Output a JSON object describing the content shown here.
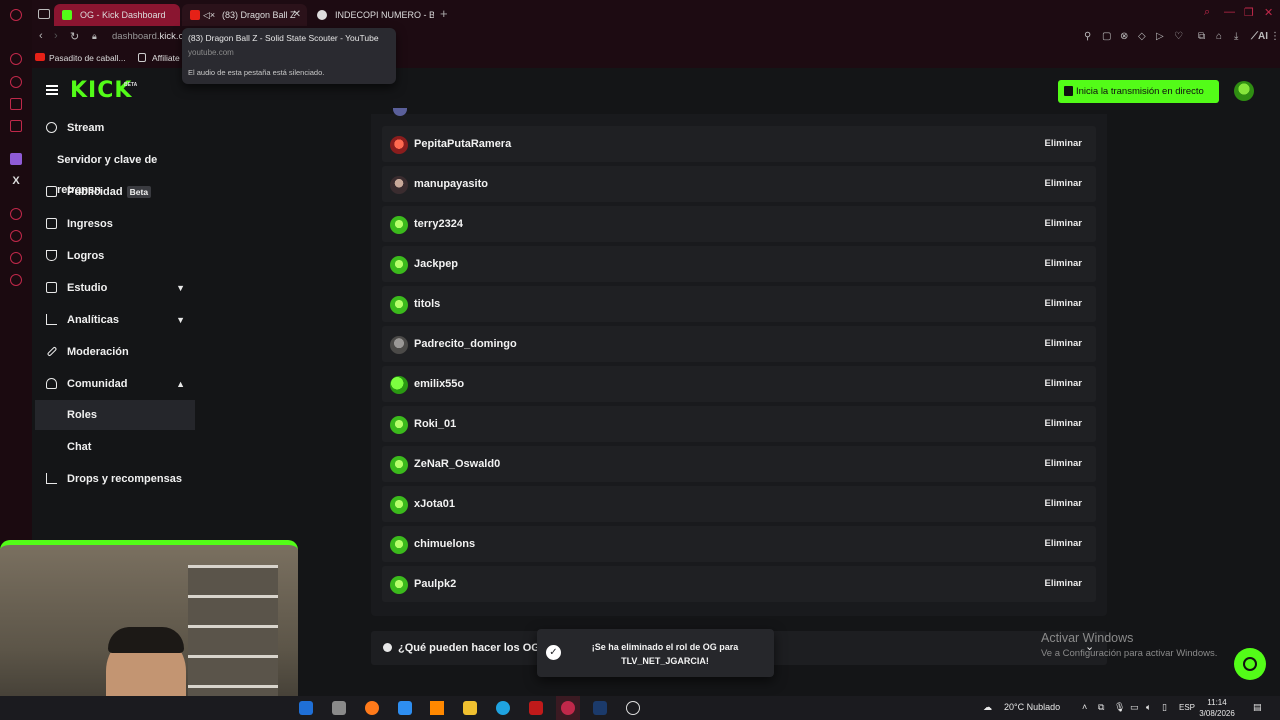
{
  "browser": {
    "tabs": [
      {
        "title": "OG - Kick Dashboard",
        "active": true
      },
      {
        "title": "(83) Dragon Ball Z",
        "muted": true
      },
      {
        "title": "INDECOPI NUMERO - Busc"
      }
    ],
    "address": {
      "prefix": "dashboard.",
      "domain": "kick.c"
    },
    "bookmarks": [
      "Pasadito de caball...",
      "Affiliate"
    ],
    "tab_tooltip": {
      "title": "(83) Dragon Ball Z - Solid State Scouter - YouTube",
      "url": "youtube.com",
      "note": "El audio de esta pestaña está silenciado."
    },
    "ai_label": "AI"
  },
  "header": {
    "logo": "KICK",
    "logo_badge": "BETA",
    "go_live_label": "Inicia la transmisión en directo"
  },
  "sidebar": {
    "items": [
      {
        "label": "Stream",
        "icon": "stream-icon"
      },
      {
        "label": "Servidor y clave de retransn",
        "icon": ""
      },
      {
        "label": "Publicidad",
        "icon": "ads-icon",
        "badge": "Beta"
      },
      {
        "label": "Ingresos",
        "icon": "revenue-icon"
      },
      {
        "label": "Logros",
        "icon": "trophy-icon"
      },
      {
        "label": "Estudio",
        "icon": "studio-icon",
        "chevron": "down"
      },
      {
        "label": "Analíticas",
        "icon": "analytics-icon",
        "chevron": "down"
      },
      {
        "label": "Moderación",
        "icon": "wrench-icon"
      },
      {
        "label": "Comunidad",
        "icon": "community-icon",
        "chevron": "up"
      },
      {
        "label": "Roles",
        "icon": "",
        "active": true
      },
      {
        "label": "Chat",
        "icon": ""
      },
      {
        "label": "Drops y recompensas",
        "icon": "drops-icon"
      }
    ]
  },
  "og_list": {
    "remove_label": "Eliminar",
    "users": [
      {
        "name": "PepitaPutaRamera",
        "avatar": "red"
      },
      {
        "name": "manupayasito",
        "avatar": "photo1"
      },
      {
        "name": "terry2324",
        "avatar": "green"
      },
      {
        "name": "Jackpep",
        "avatar": "green"
      },
      {
        "name": "titols",
        "avatar": "green"
      },
      {
        "name": "Padrecito_domingo",
        "avatar": "photo2"
      },
      {
        "name": "emilix55o",
        "avatar": "pepe"
      },
      {
        "name": "Roki_01",
        "avatar": "green"
      },
      {
        "name": "ZeNaR_Oswald0",
        "avatar": "green"
      },
      {
        "name": "xJota01",
        "avatar": "green"
      },
      {
        "name": "chimuelons",
        "avatar": "green"
      },
      {
        "name": "Paulpk2",
        "avatar": "green"
      }
    ]
  },
  "info_section": {
    "title": "¿Qué pueden hacer los OG"
  },
  "toast": {
    "message": "¡Se ha eliminado el rol de OG para TLV_NET_JGARCIA!"
  },
  "watermark": {
    "title": "Activar Windows",
    "subtitle": "Ve a Configuración para activar Windows."
  },
  "taskbar": {
    "weather": "20°C  Nublado",
    "lang": "ESP",
    "time": "11:14",
    "date": "3/08/2026"
  },
  "colors": {
    "accent": "#53fc18",
    "opera_red": "#c0284a",
    "bg": "#141517"
  }
}
